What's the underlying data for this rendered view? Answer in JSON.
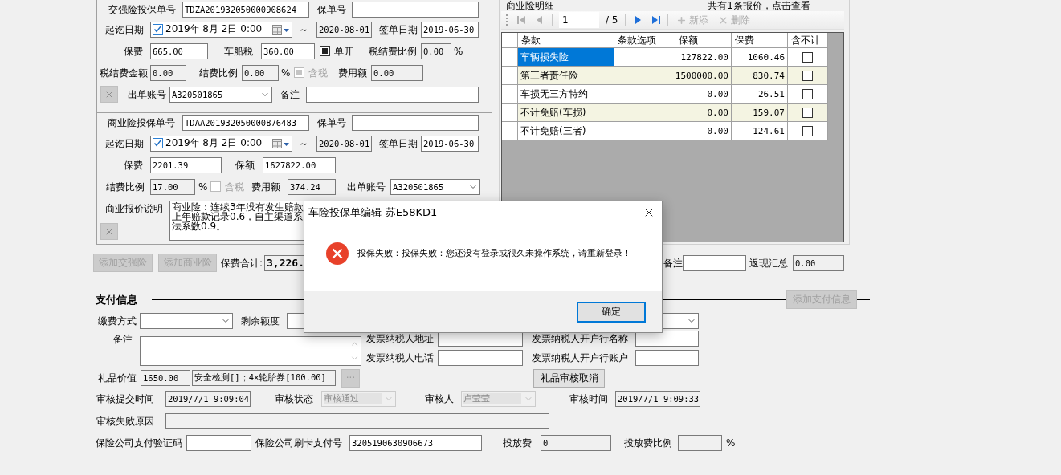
{
  "compulsory": {
    "rows": [
      {
        "items": [
          {
            "kind": "label",
            "text": "交强险投保单号"
          },
          {
            "kind": "input",
            "value": "TDZA201932050000908624"
          },
          {
            "kind": "label",
            "text": "保单号"
          },
          {
            "kind": "input"
          }
        ]
      },
      {
        "items": [
          {
            "kind": "label",
            "text": "起讫日期"
          },
          {
            "kind": "date",
            "checked": true,
            "value": "2019年  8月  2日    0:00"
          },
          {
            "kind": "unit",
            "text": "～"
          },
          {
            "kind": "readonly",
            "value": "2020-08-01"
          },
          {
            "kind": "label",
            "text": "签单日期"
          },
          {
            "kind": "input",
            "value": "2019-06-30"
          }
        ]
      },
      {
        "items": [
          {
            "kind": "label",
            "text": "保费"
          },
          {
            "kind": "input",
            "value": "665.00"
          },
          {
            "kind": "label",
            "text": "车船税"
          },
          {
            "kind": "input",
            "value": "360.00"
          },
          {
            "kind": "check",
            "text": "单开",
            "checked": true,
            "disabled": false
          },
          {
            "kind": "label",
            "text": "税结费比例"
          },
          {
            "kind": "readonly",
            "value": "0.00"
          },
          {
            "kind": "unit",
            "text": "%"
          }
        ]
      },
      {
        "items": [
          {
            "kind": "label",
            "text": "税结费金额"
          },
          {
            "kind": "readonly",
            "value": "0.00"
          },
          {
            "kind": "label",
            "text": "结费比例"
          },
          {
            "kind": "readonly",
            "value": "0.00"
          },
          {
            "kind": "unit",
            "text": "%"
          },
          {
            "kind": "check",
            "text": "含税",
            "checked": true,
            "disabled": true
          },
          {
            "kind": "label",
            "text": "费用额"
          },
          {
            "kind": "readonly",
            "value": "0.00"
          }
        ]
      },
      {
        "items": [
          {
            "kind": "remove-button",
            "disabled": true
          },
          {
            "kind": "label",
            "text": "出单账号"
          },
          {
            "kind": "select",
            "value": "A320501865",
            "disabled": false
          },
          {
            "kind": "label",
            "text": "备注"
          },
          {
            "kind": "input"
          }
        ]
      }
    ]
  },
  "commercial": {
    "rows": [
      {
        "items": [
          {
            "kind": "label",
            "text": "商业险投保单号"
          },
          {
            "kind": "input",
            "value": "TDAA201932050000876483"
          },
          {
            "kind": "label",
            "text": "保单号"
          },
          {
            "kind": "input"
          }
        ]
      },
      {
        "items": [
          {
            "kind": "label",
            "text": "起讫日期"
          },
          {
            "kind": "date",
            "checked": true,
            "value": "2019年  8月  2日    0:00"
          },
          {
            "kind": "unit",
            "text": "～"
          },
          {
            "kind": "readonly",
            "value": "2020-08-01"
          },
          {
            "kind": "label",
            "text": "签单日期"
          },
          {
            "kind": "input",
            "value": "2019-06-30"
          }
        ]
      },
      {
        "items": [
          {
            "kind": "label",
            "text": "保费"
          },
          {
            "kind": "input",
            "value": "2201.39"
          },
          {
            "kind": "label",
            "text": "保额"
          },
          {
            "kind": "input",
            "value": "1627822.00"
          }
        ]
      },
      {
        "items": [
          {
            "kind": "label",
            "text": "结费比例"
          },
          {
            "kind": "readonly",
            "value": "17.00"
          },
          {
            "kind": "unit",
            "text": "%"
          },
          {
            "kind": "check",
            "text": "含税",
            "checked": false,
            "disabled": true
          },
          {
            "kind": "label",
            "text": "费用额"
          },
          {
            "kind": "readonly",
            "value": "374.24"
          },
          {
            "kind": "label",
            "text": "出单账号"
          },
          {
            "kind": "select",
            "value": "A320501865",
            "disabled": false
          }
        ]
      },
      {
        "items": [
          {
            "kind": "remove-button",
            "disabled": true
          },
          {
            "kind": "label",
            "text": "商业报价说明"
          },
          {
            "kind": "textarea",
            "lines": [
              "商业险：连续3年没有发生赔款",
              "上年赔款记录0.6，自主渠道系",
              "法系数0.9。"
            ]
          }
        ]
      }
    ]
  },
  "commercial_detail": {
    "title": "商业险明细",
    "note": "共有1条报价，点击查看",
    "toolbar": {
      "nav_before": [
        {
          "kind": "first",
          "disabled": true
        },
        {
          "kind": "prev",
          "disabled": true
        }
      ],
      "page": "1",
      "page_count": "/ 5",
      "nav_after": [
        {
          "kind": "next",
          "disabled": false
        },
        {
          "kind": "last",
          "disabled": false
        }
      ],
      "actions": [
        {
          "kind": "add",
          "label": "新添",
          "disabled": true
        },
        {
          "kind": "delete",
          "label": "删除",
          "disabled": true
        }
      ]
    },
    "columns": [
      "条款",
      "条款选项",
      "保额",
      "保费",
      "含不计"
    ],
    "rows": [
      {
        "clause": "车辆损失险",
        "amount": "127822.00",
        "premium": "1060.46",
        "included": false,
        "selected": true
      },
      {
        "clause": "第三者责任险",
        "amount": "1500000.00",
        "premium": "830.74",
        "included": false,
        "selected": false
      },
      {
        "clause": "车损无三方特约",
        "amount": "0.00",
        "premium": "26.51",
        "included": false,
        "selected": false
      },
      {
        "clause": "不计免赔(车损)",
        "amount": "0.00",
        "premium": "159.07",
        "included": false,
        "selected": false
      },
      {
        "clause": "不计免赔(三者)",
        "amount": "0.00",
        "premium": "124.61",
        "included": false,
        "selected": false
      }
    ]
  },
  "summary": {
    "items": [
      {
        "kind": "button",
        "label": "添加交强险",
        "disabled": true
      },
      {
        "kind": "button",
        "label": "添加商业险",
        "disabled": true
      },
      {
        "kind": "label",
        "text": "保费合计:"
      },
      {
        "kind": "total",
        "value": "3,226."
      },
      {
        "kind": "label",
        "text": "备注"
      },
      {
        "kind": "input"
      },
      {
        "kind": "label",
        "text": "返现汇总"
      },
      {
        "kind": "readonly",
        "value": "0.00"
      }
    ]
  },
  "payment": {
    "title": "支付信息",
    "add_button": {
      "label": "添加支付信息",
      "disabled": true
    },
    "rows": [
      {
        "items": [
          {
            "kind": "label",
            "text": "缴费方式"
          },
          {
            "kind": "select",
            "disabled": false
          },
          {
            "kind": "label",
            "text": "剩余额度"
          },
          {
            "kind": "input"
          },
          {
            "kind": "select",
            "disabled": false
          }
        ]
      },
      {
        "items": [
          {
            "kind": "label",
            "text": "备注"
          },
          {
            "kind": "memo"
          },
          {
            "kind": "stack",
            "rows": [
              {
                "items": [
                  {
                    "kind": "label",
                    "text": "发票纳税人地址"
                  },
                  {
                    "kind": "input"
                  },
                  {
                    "kind": "label",
                    "text": "发票纳税人开户行名称"
                  },
                  {
                    "kind": "input"
                  }
                ]
              },
              {
                "items": [
                  {
                    "kind": "label",
                    "text": "发票纳税人电话"
                  },
                  {
                    "kind": "input"
                  },
                  {
                    "kind": "label",
                    "text": "发票纳税人开户行账户"
                  },
                  {
                    "kind": "input"
                  }
                ]
              }
            ]
          }
        ]
      },
      {
        "items": [
          {
            "kind": "label",
            "text": "礼品价值"
          },
          {
            "kind": "readonly",
            "value": "1650.00"
          },
          {
            "kind": "readonly",
            "value": "安全检测[]；4×轮胎券[100.00]"
          },
          {
            "kind": "button",
            "label": "···",
            "disabled": true
          },
          {
            "kind": "button",
            "label": "礼品审核取消",
            "disabled": false
          }
        ]
      },
      {
        "items": [
          {
            "kind": "label",
            "text": "审核提交时间"
          },
          {
            "kind": "readonly",
            "value": "2019/7/1 9:09:04"
          },
          {
            "kind": "label",
            "text": "审核状态"
          },
          {
            "kind": "select",
            "value": "审核通过",
            "disabled": true
          },
          {
            "kind": "label",
            "text": "审核人"
          },
          {
            "kind": "select",
            "value": "卢莹莹",
            "disabled": true
          },
          {
            "kind": "label",
            "text": "审核时间"
          },
          {
            "kind": "readonly",
            "value": "2019/7/1 9:09:33"
          }
        ]
      },
      {
        "items": [
          {
            "kind": "label",
            "text": "审核失败原因"
          },
          {
            "kind": "readonly"
          }
        ]
      },
      {
        "items": [
          {
            "kind": "label",
            "text": "保险公司支付验证码"
          },
          {
            "kind": "input"
          },
          {
            "kind": "label",
            "text": "保险公司刷卡支付号"
          },
          {
            "kind": "input",
            "value": "3205190630906673"
          },
          {
            "kind": "label",
            "text": "投放费"
          },
          {
            "kind": "readonly",
            "value": "0"
          },
          {
            "kind": "label",
            "text": "投放费比例"
          },
          {
            "kind": "readonly"
          },
          {
            "kind": "unit",
            "text": "%"
          }
        ]
      }
    ]
  },
  "dialog": {
    "title": "车险投保单编辑-苏E58KD1",
    "message": "投保失败：投保失败：您还没有登录或很久未操作系统，请重新登录！",
    "button": "确定"
  }
}
